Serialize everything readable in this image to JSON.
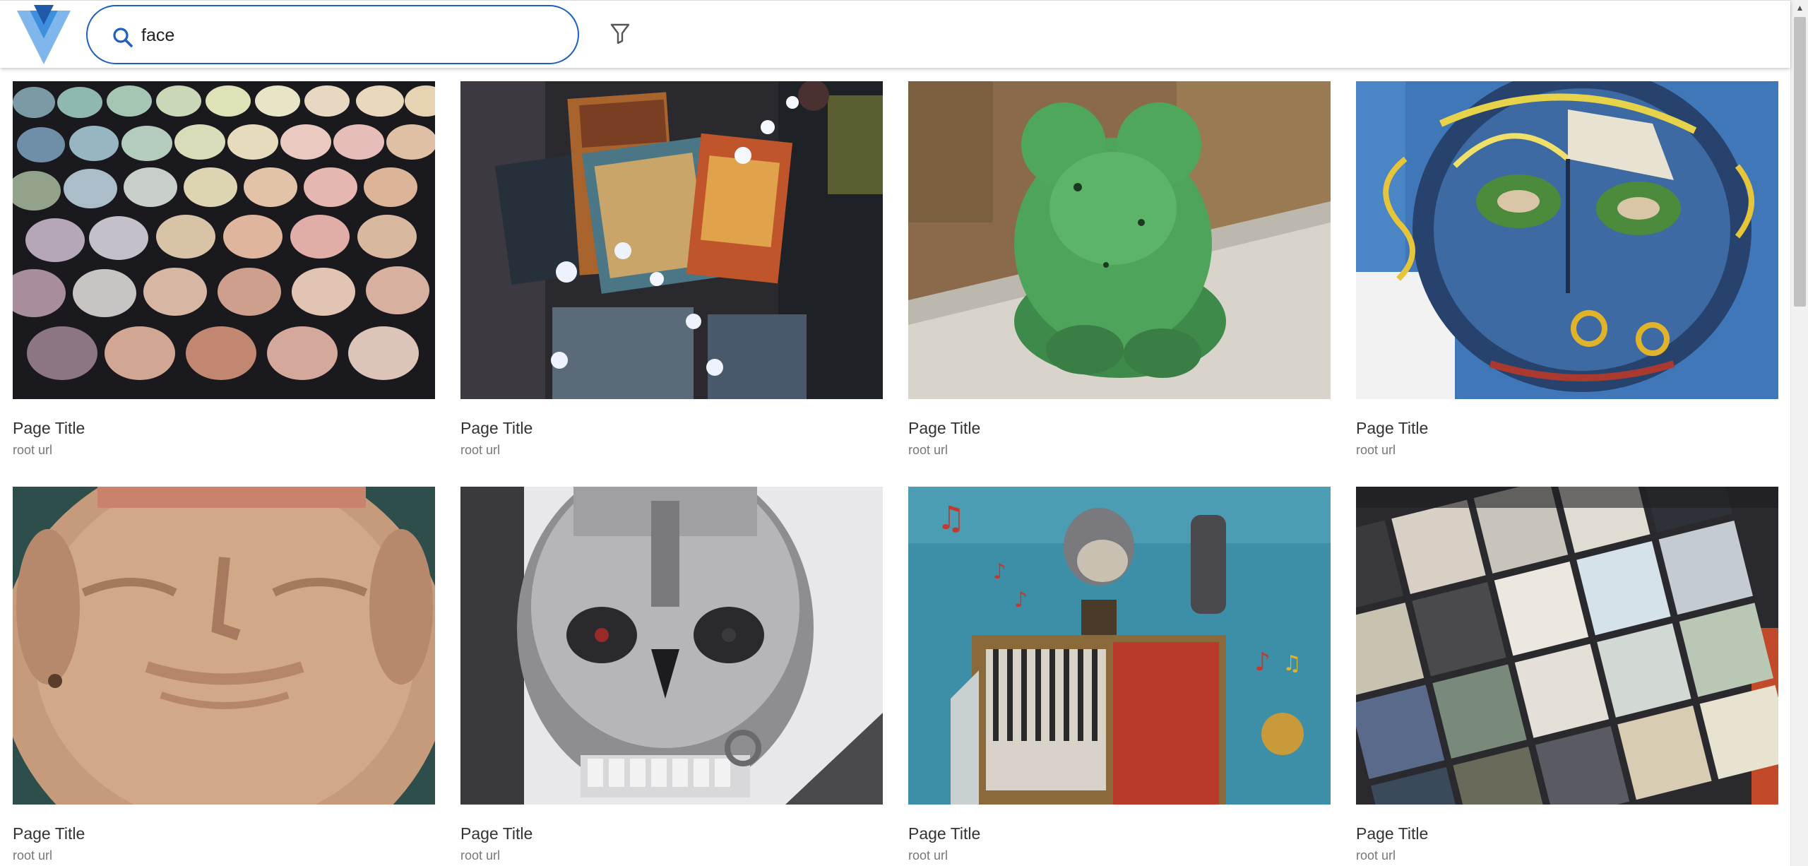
{
  "header": {
    "logo_icon": "v-logo-icon",
    "search": {
      "value": "face",
      "placeholder": "",
      "icon": "search-icon"
    },
    "filter_icon": "filter-funnel-icon",
    "accent_color": "#1e5fbf"
  },
  "results": [
    {
      "title": "Page Title",
      "subtitle": "root url",
      "image": "eyeshadow-palette"
    },
    {
      "title": "Page Title",
      "subtitle": "root url",
      "image": "battletech-games"
    },
    {
      "title": "Page Title",
      "subtitle": "root url",
      "image": "green-figurine"
    },
    {
      "title": "Page Title",
      "subtitle": "root url",
      "image": "painted-face"
    },
    {
      "title": "Page Title",
      "subtitle": "root url",
      "image": "clay-face"
    },
    {
      "title": "Page Title",
      "subtitle": "root url",
      "image": "robot-skull"
    },
    {
      "title": "Page Title",
      "subtitle": "root url",
      "image": "accordion-robot"
    },
    {
      "title": "Page Title",
      "subtitle": "root url",
      "image": "cd-collection"
    }
  ]
}
